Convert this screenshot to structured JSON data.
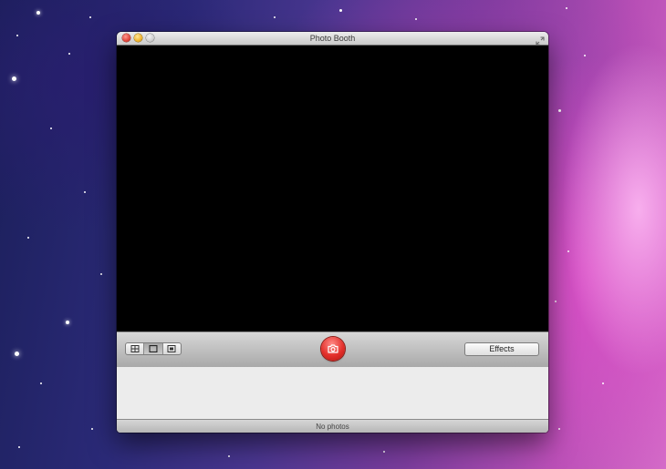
{
  "window": {
    "title": "Photo Booth"
  },
  "toolbar": {
    "view_modes": [
      {
        "name": "four-up-view",
        "icon": "grid-4-icon",
        "active": false
      },
      {
        "name": "single-view",
        "icon": "single-frame-icon",
        "active": true
      },
      {
        "name": "video-view",
        "icon": "film-strip-icon",
        "active": false
      }
    ],
    "shutter_icon": "camera-icon",
    "effects_label": "Effects"
  },
  "status": {
    "text": "No photos"
  },
  "colors": {
    "shutter": "#e3302b",
    "viewport": "#000000",
    "tray": "#ececec"
  }
}
